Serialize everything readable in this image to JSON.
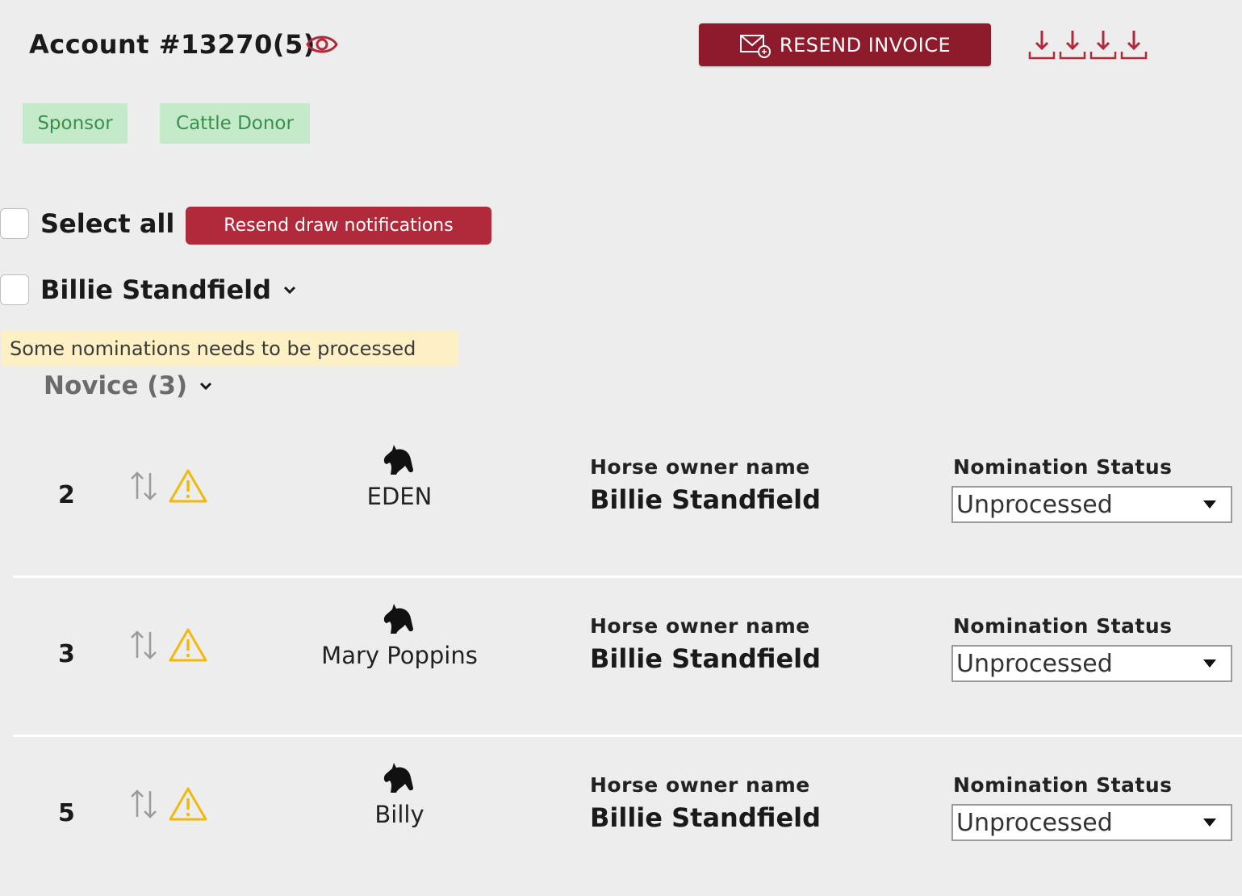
{
  "header": {
    "account_title": "Account #13270(5)",
    "resend_invoice_label": "RESEND INVOICE"
  },
  "tags": [
    "Sponsor",
    "Cattle Donor"
  ],
  "bulk": {
    "select_all_label": "Select all",
    "resend_draw_label": "Resend draw notifications"
  },
  "person": {
    "name": "Billie Standfield",
    "warning": "Some nominations needs to be processed"
  },
  "group": {
    "label": "Novice (3)"
  },
  "rows": [
    {
      "rank": "2",
      "horse": "EDEN",
      "owner_caption": "Horse owner name",
      "owner": "Billie Standfield",
      "status_caption": "Nomination Status",
      "status": "Unprocessed"
    },
    {
      "rank": "3",
      "horse": "Mary Poppins",
      "owner_caption": "Horse owner name",
      "owner": "Billie Standfield",
      "status_caption": "Nomination Status",
      "status": "Unprocessed"
    },
    {
      "rank": "5",
      "horse": "Billy",
      "owner_caption": "Horse owner name",
      "owner": "Billie Standfield",
      "status_caption": "Nomination Status",
      "status": "Unprocessed"
    }
  ],
  "colors": {
    "accent_dark": "#8e1b2c",
    "accent": "#b12a3b",
    "tag_bg": "#c4ebc9",
    "tag_text": "#3b8f4c",
    "warning_bg": "#fdf0c4",
    "warning_icon": "#f0b90b"
  },
  "icons": [
    "eye-icon",
    "mail-icon",
    "download-icon",
    "chevron-down-icon",
    "sort-icon",
    "warning-icon",
    "horse-icon",
    "caret-down-icon"
  ]
}
